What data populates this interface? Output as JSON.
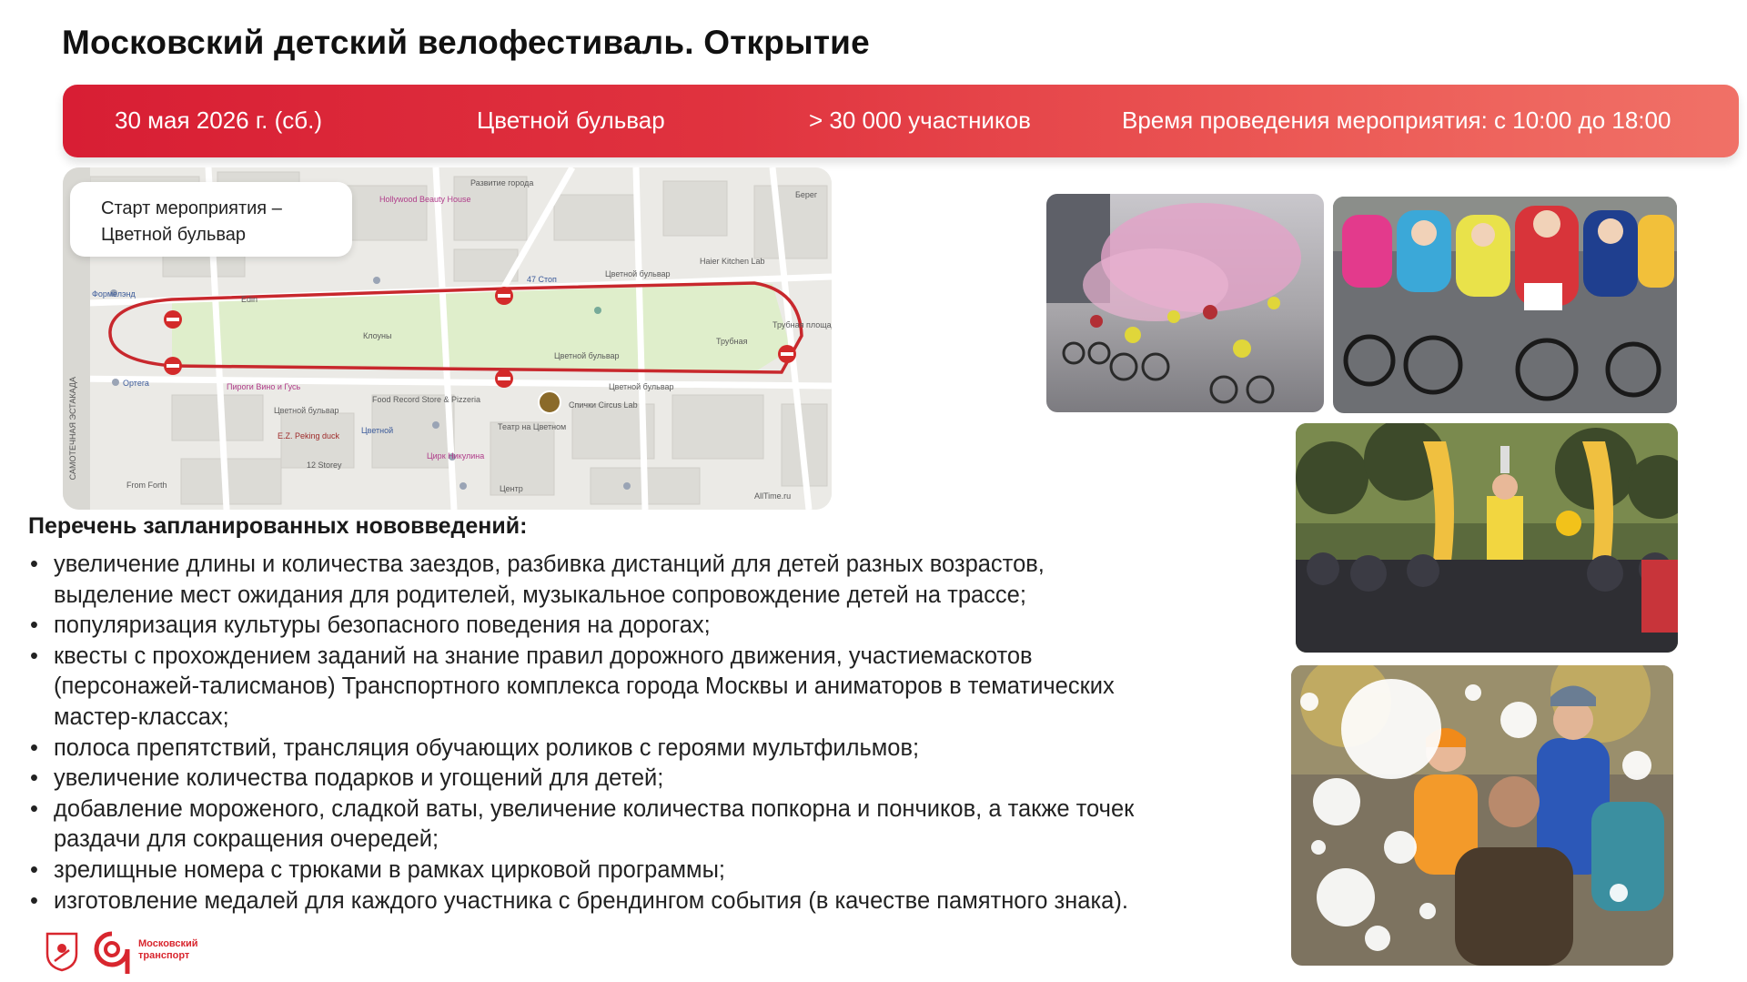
{
  "title": "Московский детский велофестиваль. Открытие",
  "banner": {
    "date": "30 мая 2026 г. (сб.)",
    "place": "Цветной бульвар",
    "participants": "> 30 000 участников",
    "time": "Время проведения мероприятия: с 10:00 до 18:00"
  },
  "map": {
    "note_line1": "Старт мероприятия –",
    "note_line2": "Цветной  бульвар",
    "labels": {
      "hollywood": "Hollywood Beauty House",
      "razvitie": "Развитие города",
      "bereg": "Берег",
      "haier": "Haier Kitchen Lab",
      "fotostop": "47 Стоп",
      "formenlend": "Формелэнд",
      "edin": "Edin",
      "klouny": "Клоуны",
      "tsvetnoy_bulvar_park": "Цветной бульвар",
      "trubnaya": "Трубная",
      "trubnaya_sq": "Трубная площадь",
      "ortega": "Ортега",
      "pirogi": "Пироги Вино и Гусь",
      "metro_tsvetnoy": "Цветной бульвар",
      "food_record": "Food Record Store & Pizzeria",
      "circus": "Спички Circus Lab",
      "tsvetnoy_bulvar_street": "Цветной бульвар",
      "tsvetnoy_street_top": "Цветной бульвар",
      "teatr": "Театр на Цветном",
      "ez": "E.Z. Peking duck",
      "tsvetnoy_shop": "Цветной",
      "storey": "12 Storey",
      "tsirk": "Цирк Никулина",
      "from_forth": "From Forth",
      "tsentr": "Центр",
      "allttime": "AllTime.ru",
      "samotechnaya": "САМОТЕЧНАЯ ЭСТАКАДА"
    }
  },
  "list": {
    "heading": "Перечень запланированных нововведений:",
    "items": [
      {
        "lines": [
          "увеличение длины и количества заездов, разбивка дистанций для детей разных возрастов,",
          "выделение мест ожидания для родителей, музыкальное сопровождение детей на трассе;"
        ]
      },
      {
        "lines": [
          "популяризация культуры безопасного поведения на дорогах;"
        ]
      },
      {
        "lines": [
          "квесты с прохождением заданий на знание правил дорожного движения,  участиемаскотов",
          "(персонажей-талисманов) Транспортного комплекса города Москвы и аниматоров в тематических",
          "мастер-классах;"
        ]
      },
      {
        "lines": [
          "полоса препятствий, трансляция обучающих роликов с героями мультфильмов;"
        ]
      },
      {
        "lines": [
          "увеличение количества подарков и угощений для детей;"
        ]
      },
      {
        "lines": [
          "добавление мороженого, сладкой ваты, увеличение количества попкорна и пончиков,  а также точек",
          "раздачи для сокращения очередей;"
        ]
      },
      {
        "lines": [
          "зрелищные номера с трюками в рамках цирковой программы;"
        ]
      },
      {
        "lines": [
          "изготовление медалей для каждого участника с  брендингом события (в качестве памятного знака)."
        ]
      }
    ]
  },
  "footer": {
    "logo_line1": "Московский",
    "logo_line2": "транспорт"
  },
  "colors": {
    "banner_start": "#d81e34",
    "banner_end": "#f07167",
    "route": "#c8282d",
    "logo_red": "#d8262e"
  }
}
